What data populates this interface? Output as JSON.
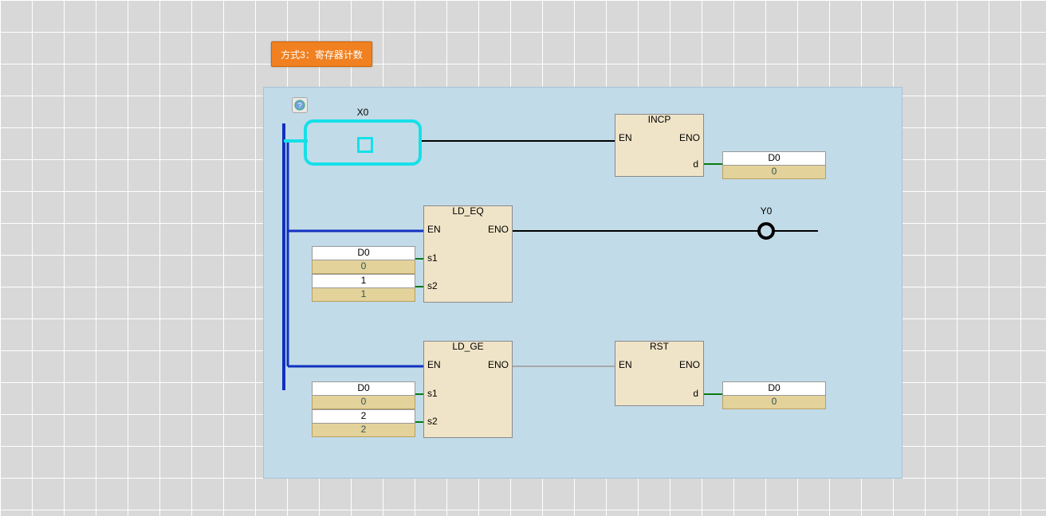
{
  "header": {
    "title": "方式3：寄存器计数"
  },
  "contact": {
    "label": "X0"
  },
  "coil": {
    "label": "Y0"
  },
  "blocks": {
    "incp": {
      "title": "INCP",
      "en": "EN",
      "eno": "ENO",
      "d": "d"
    },
    "ld_eq": {
      "title": "LD_EQ",
      "en": "EN",
      "eno": "ENO",
      "s1": "s1",
      "s2": "s2"
    },
    "ld_ge": {
      "title": "LD_GE",
      "en": "EN",
      "eno": "ENO",
      "s1": "s1",
      "s2": "s2"
    },
    "rst": {
      "title": "RST",
      "en": "EN",
      "eno": "ENO",
      "d": "d"
    }
  },
  "tags": {
    "incp_d": {
      "name": "D0",
      "value": "0"
    },
    "eq_s1": {
      "name": "D0",
      "value": "0"
    },
    "eq_s2": {
      "name": "1",
      "value": "1"
    },
    "ge_s1": {
      "name": "D0",
      "value": "0"
    },
    "ge_s2": {
      "name": "2",
      "value": "2"
    },
    "rst_d": {
      "name": "D0",
      "value": "0"
    }
  }
}
